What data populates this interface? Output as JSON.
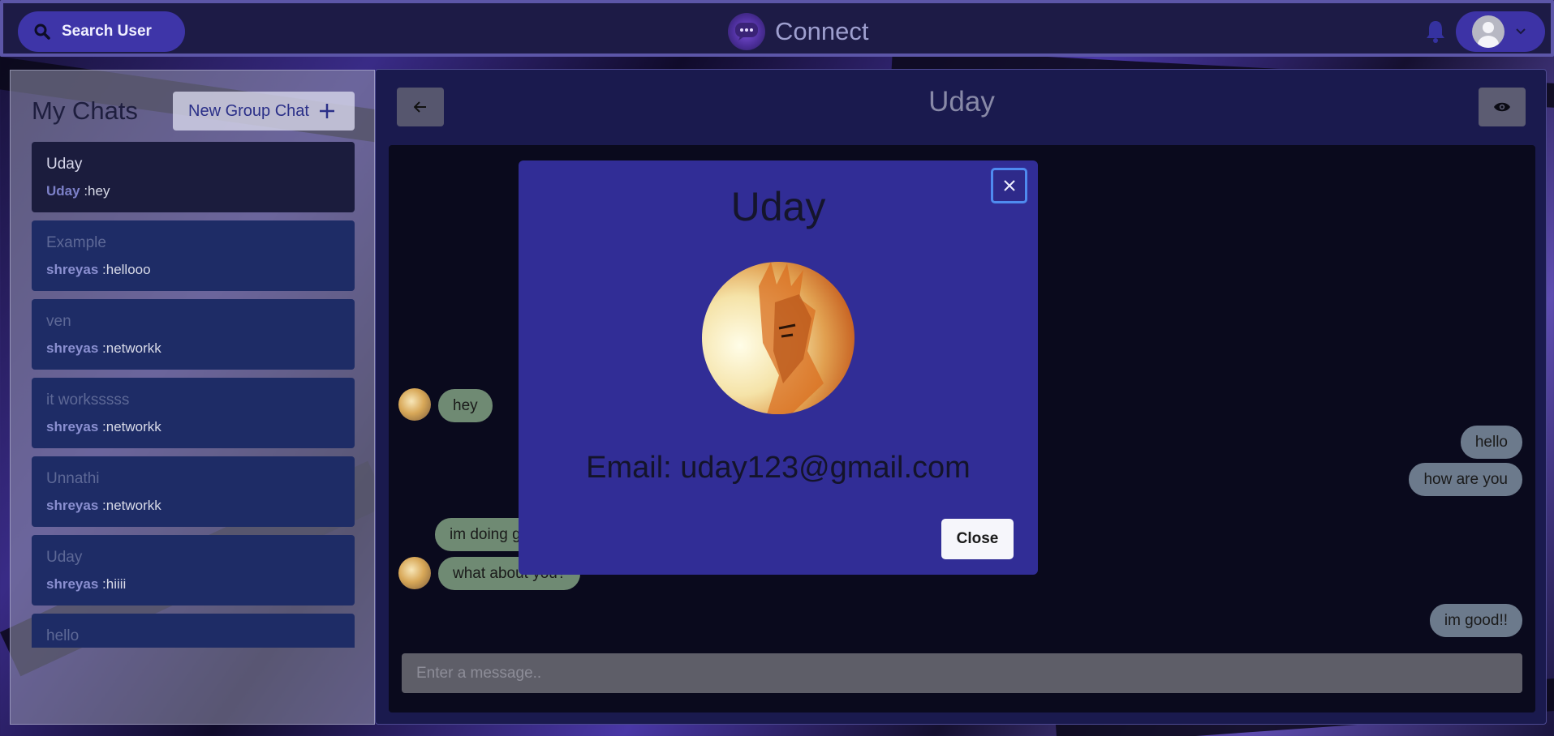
{
  "header": {
    "search_label": "Search User",
    "app_name": "Connect",
    "icons": {
      "search": "search-icon",
      "logo": "chat-bubble-logo",
      "bell": "bell-icon",
      "avatar": "user-avatar",
      "chevron": "chevron-down-icon"
    }
  },
  "sidebar": {
    "title": "My Chats",
    "new_group_label": "New Group Chat",
    "chats": [
      {
        "name": "Uday",
        "sender": "Uday",
        "message": ":hey",
        "active": true
      },
      {
        "name": "Example",
        "sender": "shreyas",
        "message": ":hellooo"
      },
      {
        "name": "ven",
        "sender": "shreyas",
        "message": ":networkk"
      },
      {
        "name": "it worksssss",
        "sender": "shreyas",
        "message": ":networkk"
      },
      {
        "name": "Unnathi",
        "sender": "shreyas",
        "message": ":networkk"
      },
      {
        "name": "Uday",
        "sender": "shreyas",
        "message": ":hiiii"
      },
      {
        "name": "hello",
        "sender": "",
        "message": ""
      }
    ]
  },
  "chat": {
    "title": "Uday",
    "messages": [
      {
        "text": "hey",
        "direction": "in"
      },
      {
        "text": "hello",
        "direction": "out"
      },
      {
        "text": "how are you",
        "direction": "out"
      },
      {
        "text": "im doing g",
        "direction": "in"
      },
      {
        "text": "what about you?",
        "direction": "in"
      },
      {
        "text": "im good!!",
        "direction": "out"
      }
    ],
    "input_placeholder": "Enter a message.."
  },
  "modal": {
    "title": "Uday",
    "email": "Email: uday123@gmail.com",
    "close_label": "Close"
  },
  "colors": {
    "accent": "#3e35a8",
    "modal_bg": "#312d96",
    "incoming_bubble": "#6f8a73",
    "outgoing_bubble": "#6c7a8c"
  }
}
